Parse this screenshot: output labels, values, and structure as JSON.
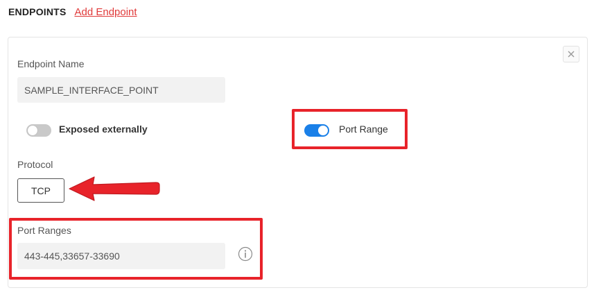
{
  "header": {
    "title": "ENDPOINTS",
    "add_link": "Add Endpoint"
  },
  "endpoint": {
    "name_label": "Endpoint Name",
    "name_value": "SAMPLE_INTERFACE_POINT",
    "exposed_toggle": {
      "label": "Exposed externally",
      "state": "off"
    },
    "port_range_toggle": {
      "label": "Port Range",
      "state": "on"
    },
    "protocol_label": "Protocol",
    "protocol_value": "TCP",
    "port_ranges_label": "Port Ranges",
    "port_ranges_value": "443-445,33657-33690"
  },
  "icons": {
    "close": "close-icon",
    "info": "info-icon",
    "annotation_arrow": "arrow-left-icon"
  },
  "colors": {
    "accent_link": "#e03a3a",
    "toggle_on": "#1a80e8",
    "toggle_off": "#c9c9c9",
    "annotation_red": "#e8232a"
  }
}
